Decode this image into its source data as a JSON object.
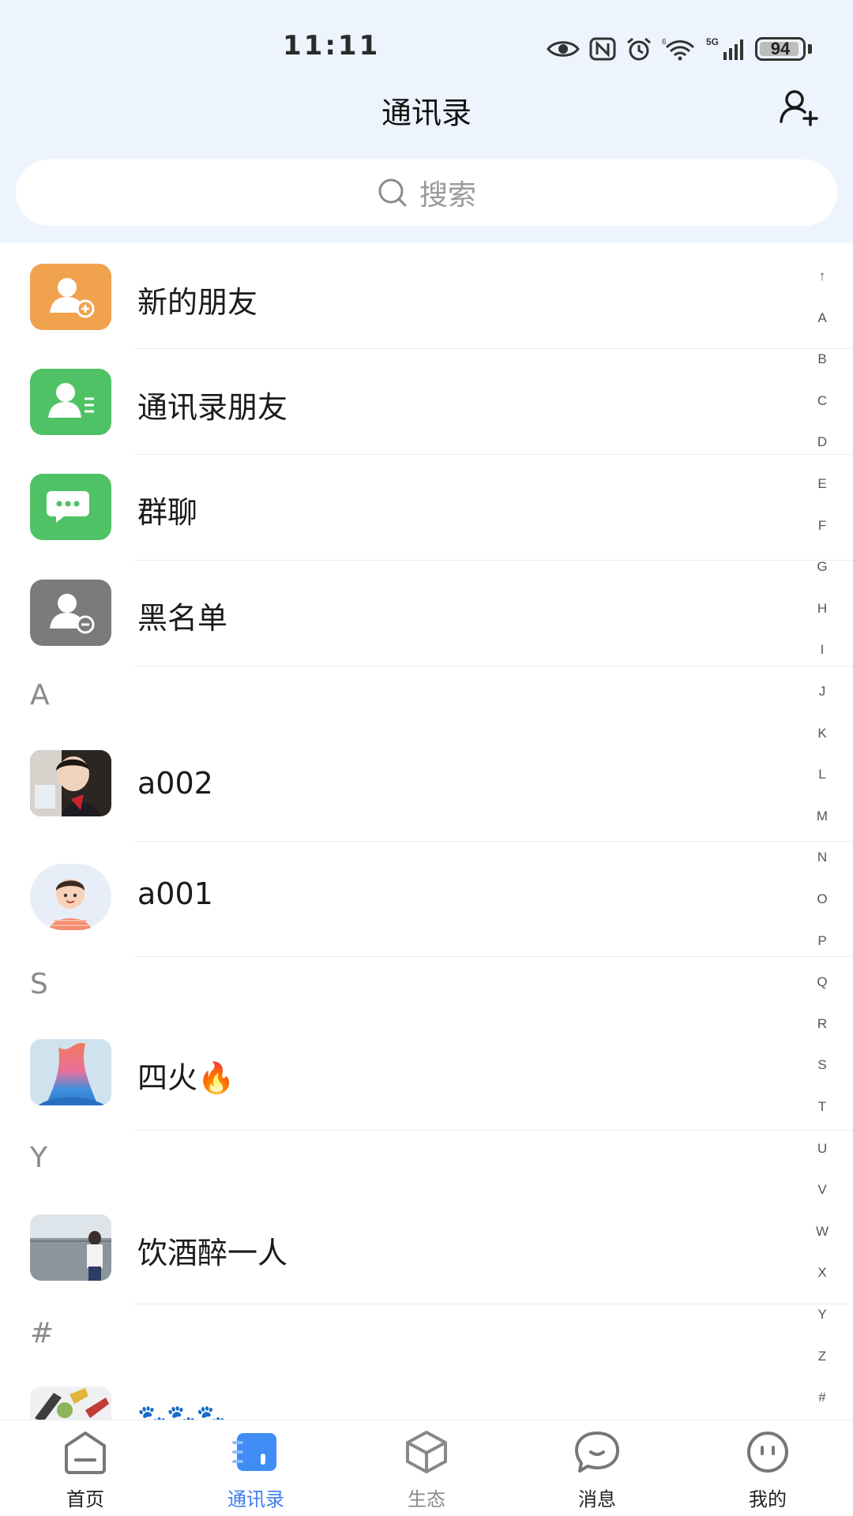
{
  "status_bar": {
    "time": "11:11",
    "battery": "94",
    "battery_level": 0.94,
    "network": "5G",
    "wifi_badge": "6",
    "icons": [
      "eye-icon",
      "nfc-icon",
      "alarm-icon",
      "wifi-icon",
      "signal-icon",
      "battery-icon"
    ]
  },
  "header": {
    "title": "通讯录",
    "add_icon": "add-contact-icon"
  },
  "search": {
    "placeholder": "搜索",
    "icon": "search-icon"
  },
  "quick_entries": [
    {
      "label": "新的朋友",
      "icon": "new-friend-icon",
      "color": "#f0a24e"
    },
    {
      "label": "通讯录朋友",
      "icon": "contacts-friend-icon",
      "color": "#4fc265"
    },
    {
      "label": "群聊",
      "icon": "group-chat-icon",
      "color": "#4fc265"
    },
    {
      "label": "黑名单",
      "icon": "blacklist-icon",
      "color": "#7b7b7b"
    }
  ],
  "sections": [
    {
      "letter": "A",
      "contacts": [
        {
          "name": "a002"
        },
        {
          "name": "a001"
        }
      ]
    },
    {
      "letter": "S",
      "contacts": [
        {
          "name": "四火🔥"
        }
      ]
    },
    {
      "letter": "Y",
      "contacts": [
        {
          "name": "饮酒醉一人"
        }
      ]
    },
    {
      "letter": "#",
      "contacts": [
        {
          "name": "🐾🐾🐾"
        }
      ]
    }
  ],
  "index_bar": [
    "↑",
    "A",
    "B",
    "C",
    "D",
    "E",
    "F",
    "G",
    "H",
    "I",
    "J",
    "K",
    "L",
    "M",
    "N",
    "O",
    "P",
    "Q",
    "R",
    "S",
    "T",
    "U",
    "V",
    "W",
    "X",
    "Y",
    "Z",
    "#"
  ],
  "tabs": [
    {
      "label": "首页",
      "icon": "home-icon",
      "state": "normal"
    },
    {
      "label": "通讯录",
      "icon": "contacts-icon",
      "state": "active"
    },
    {
      "label": "生态",
      "icon": "cube-icon",
      "state": "muted"
    },
    {
      "label": "消息",
      "icon": "message-icon",
      "state": "normal"
    },
    {
      "label": "我的",
      "icon": "profile-icon",
      "state": "normal"
    }
  ],
  "colors": {
    "accent": "#3f7df0",
    "header_bg": "#eef4fd",
    "orange": "#f0a24e",
    "green": "#4fc265",
    "gray": "#7b7b7b"
  }
}
